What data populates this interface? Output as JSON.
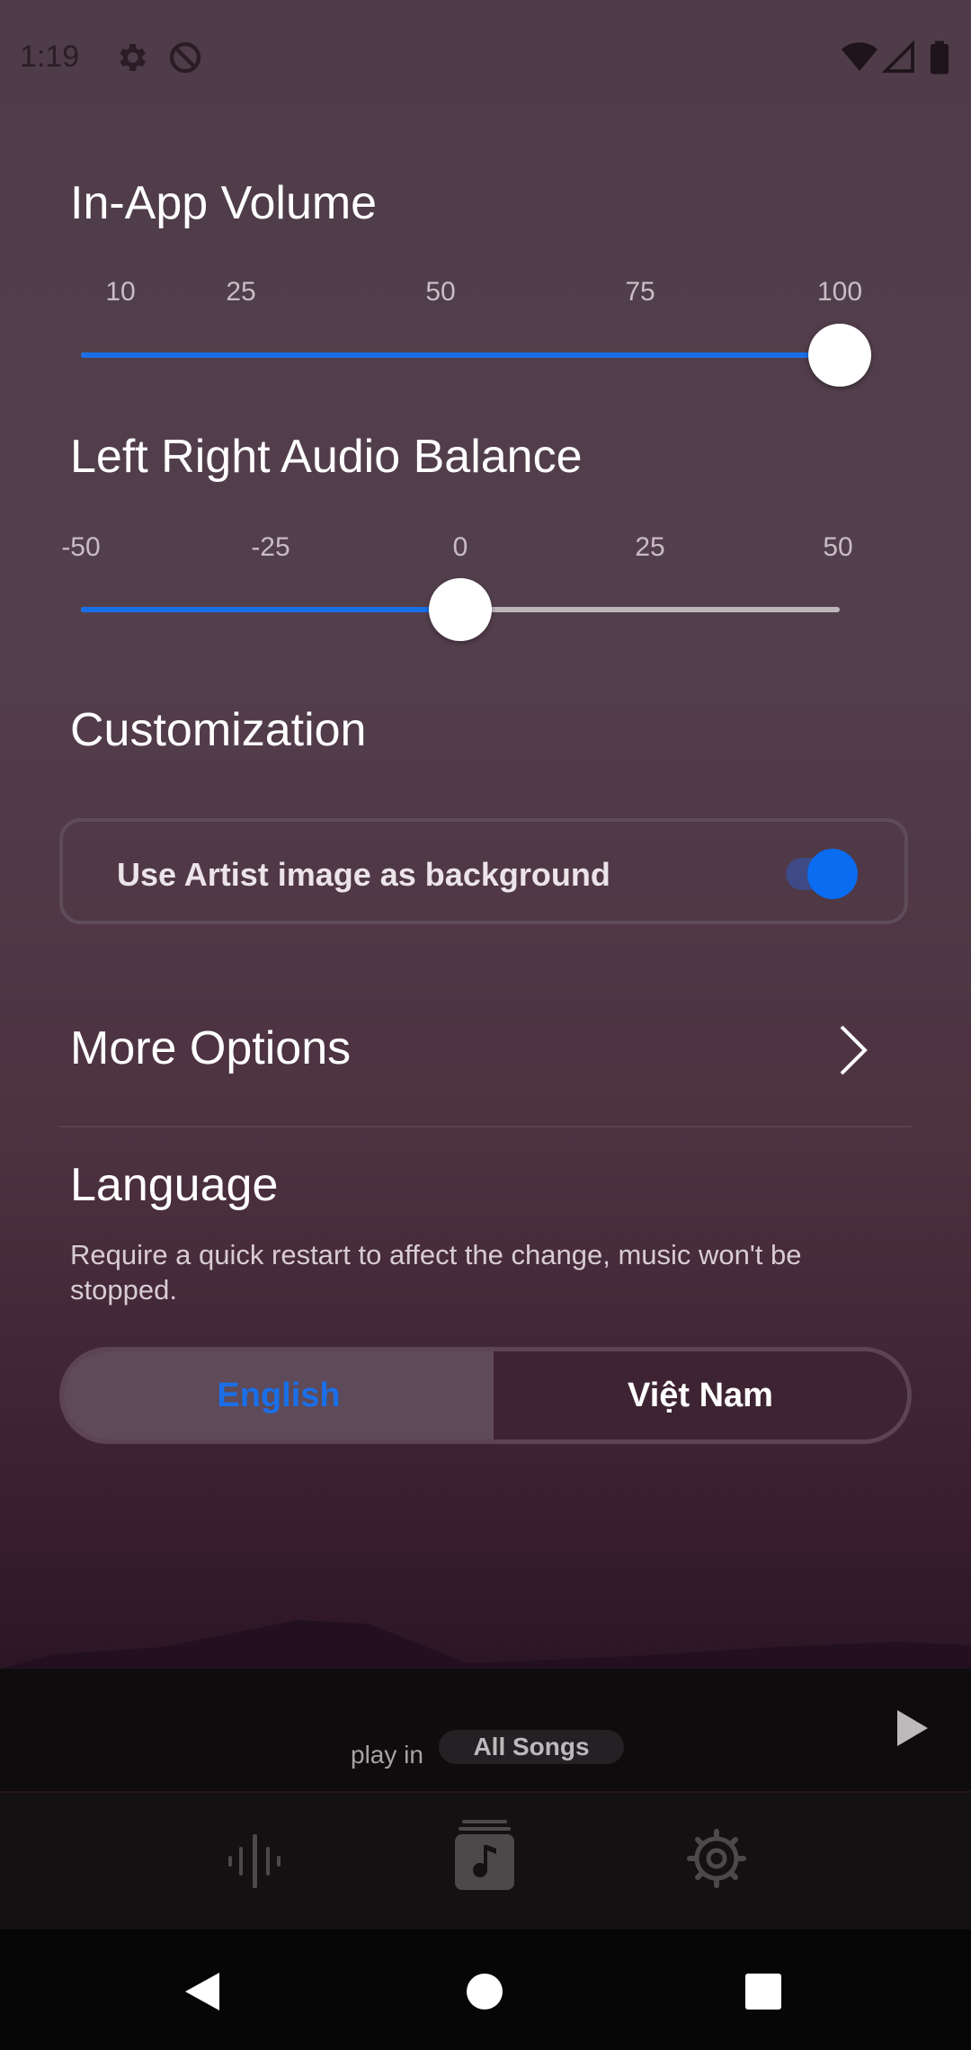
{
  "status_bar": {
    "time": "1:19"
  },
  "volume": {
    "title": "In-App Volume",
    "ticks": [
      "10",
      "25",
      "50",
      "75",
      "100"
    ],
    "value": 100
  },
  "balance": {
    "title": "Left Right Audio Balance",
    "ticks": [
      "-50",
      "-25",
      "0",
      "25",
      "50"
    ],
    "value": 0
  },
  "customization": {
    "title": "Customization",
    "artist_bg_label": "Use Artist image as background",
    "artist_bg_enabled": true
  },
  "more_options": {
    "label": "More Options"
  },
  "language": {
    "title": "Language",
    "description": "Require a quick restart to affect the change, music won't be stopped.",
    "options": [
      "English",
      "Việt Nam"
    ],
    "selected": "English"
  },
  "player": {
    "play_in_label": "play in",
    "playlist": "All Songs"
  },
  "colors": {
    "accent": "#1a6fe8",
    "track_inactive": "#bdb6ba"
  }
}
